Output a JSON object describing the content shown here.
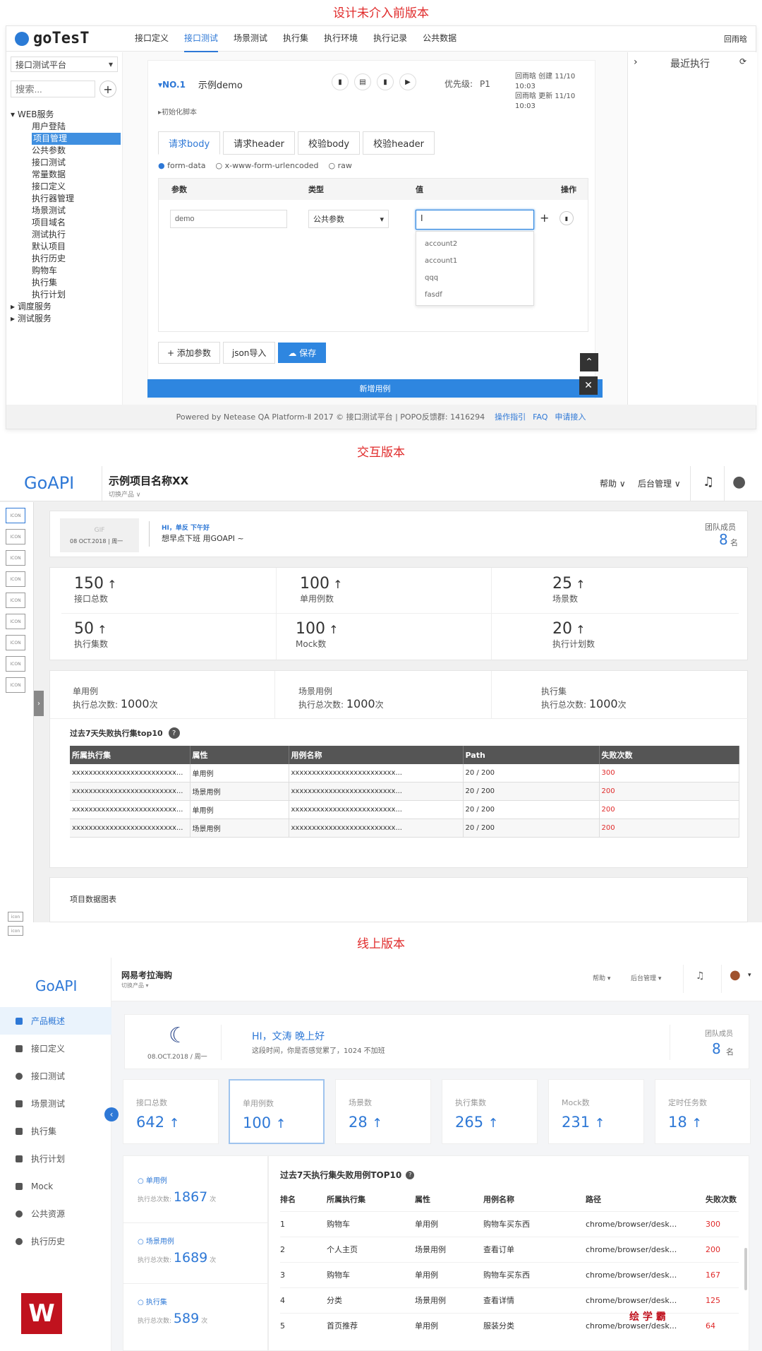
{
  "titles": {
    "before": "设计未介入前版本",
    "interactive": "交互版本",
    "online": "线上版本"
  },
  "s1": {
    "logo": "goTesT",
    "nav": [
      "接口定义",
      "接口测试",
      "场景测试",
      "执行集",
      "执行环境",
      "执行记录",
      "公共数据"
    ],
    "user": "回雨晗",
    "platform": "接口测试平台",
    "search_placeholder": "搜索...",
    "tree": {
      "root": "WEB服务",
      "items": [
        "用户登陆",
        "项目管理",
        "公共参数",
        "接口测试",
        "常量数据",
        "接口定义",
        "执行器管理",
        "场景测试",
        "项目域名",
        "测试执行",
        "默认项目",
        "执行历史",
        "购物车",
        "执行集",
        "执行计划"
      ],
      "selected": "项目管理",
      "closed": [
        "调度服务",
        "测试服务"
      ]
    },
    "case_no": "▾NO.1",
    "case_name": "示例demo",
    "priority_label": "优先级:",
    "priority": "P1",
    "meta1": "回雨晗 创建 11/10 10:03",
    "meta2": "回雨晗 更新 11/10 10:03",
    "init_script": "▸初始化脚本",
    "tabs": [
      "请求body",
      "请求header",
      "校验body",
      "校验header"
    ],
    "radios": [
      "form-data",
      "x-www-form-urlencoded",
      "raw"
    ],
    "cols": [
      "参数",
      "类型",
      "值",
      "操作"
    ],
    "row": {
      "param": "demo",
      "type": "公共参数",
      "value": "I"
    },
    "dropdown": [
      "account2",
      "account1",
      "qqq",
      "fasdf"
    ],
    "btn_add": "+ 添加参数",
    "btn_json": "json导入",
    "btn_save": "保存",
    "btn_new": "新增用例",
    "recent": "最近执行",
    "footer": "Powered by Netease QA Platform-Ⅱ 2017 © 接口测试平台 | POPO反馈群: 1416294",
    "footer_links": [
      "操作指引",
      "FAQ",
      "申请接入"
    ]
  },
  "s2": {
    "logo": "GoAPI",
    "project": "示例项目名称XX",
    "switch": "切换产品 ∨",
    "help": "帮助 ∨",
    "admin": "后台管理 ∨",
    "gif": "GIF",
    "date": "08 OCT.2018 | 周一",
    "greet": "HI，单反 下午好",
    "slogan": "想早点下班 用GOAPI ~",
    "team_label": "团队成员",
    "team_num": "8",
    "team_unit": "名",
    "icon_label": "ICON",
    "small_icon": "icon",
    "stats": [
      {
        "v": "150",
        "l": "接口总数"
      },
      {
        "v": "100",
        "l": "单用例数"
      },
      {
        "v": "25",
        "l": "场景数"
      },
      {
        "v": "50",
        "l": "执行集数"
      },
      {
        "v": "100",
        "l": "Mock数"
      },
      {
        "v": "20",
        "l": "执行计划数"
      }
    ],
    "up": "↑",
    "runs": [
      {
        "t": "单用例",
        "p": "执行总次数:",
        "v": "1000",
        "u": "次"
      },
      {
        "t": "场景用例",
        "p": "执行总次数:",
        "v": "1000",
        "u": "次"
      },
      {
        "t": "执行集",
        "p": "执行总次数:",
        "v": "1000",
        "u": "次"
      }
    ],
    "table_title": "过去7天失败执行集top10",
    "help_mark": "?",
    "cols": [
      "所属执行集",
      "属性",
      "用例名称",
      "Path",
      "失败次数"
    ],
    "rows": [
      [
        "xxxxxxxxxxxxxxxxxxxxxxxxx...",
        "单用例",
        "xxxxxxxxxxxxxxxxxxxxxxxxx...",
        "20 / 200",
        "300"
      ],
      [
        "xxxxxxxxxxxxxxxxxxxxxxxxx...",
        "场景用例",
        "xxxxxxxxxxxxxxxxxxxxxxxxx...",
        "20 / 200",
        "200"
      ],
      [
        "xxxxxxxxxxxxxxxxxxxxxxxxx...",
        "单用例",
        "xxxxxxxxxxxxxxxxxxxxxxxxx...",
        "20 / 200",
        "200"
      ],
      [
        "xxxxxxxxxxxxxxxxxxxxxxxxx...",
        "场景用例",
        "xxxxxxxxxxxxxxxxxxxxxxxxx...",
        "20 / 200",
        "200"
      ]
    ],
    "chart_title": "项目数据图表"
  },
  "s3": {
    "logo": "GoAPI",
    "project": "网易考拉海购",
    "switch": "切换产品 ▾",
    "help": "帮助 ▾",
    "admin": "后台管理 ▾",
    "menu": [
      "产品概述",
      "接口定义",
      "接口测试",
      "场景测试",
      "执行集",
      "执行计划",
      "Mock",
      "公共资源",
      "执行历史"
    ],
    "date": "08.OCT.2018 / 周一",
    "greet": "HI，文涛 晚上好",
    "sub": "这段时间，你是否感觉累了，1024 不加班",
    "team_label": "团队成员",
    "team_num": "8",
    "team_unit": "名",
    "stats": [
      {
        "l": "接口总数",
        "v": "642"
      },
      {
        "l": "单用例数",
        "v": "100"
      },
      {
        "l": "场景数",
        "v": "28"
      },
      {
        "l": "执行集数",
        "v": "265"
      },
      {
        "l": "Mock数",
        "v": "231"
      },
      {
        "l": "定时任务数",
        "v": "18"
      }
    ],
    "up": "↑",
    "runs": [
      {
        "t": "单用例",
        "p": "执行总次数:",
        "v": "1867",
        "u": "次"
      },
      {
        "t": "场景用例",
        "p": "执行总次数:",
        "v": "1689",
        "u": "次"
      },
      {
        "t": "执行集",
        "p": "执行总次数:",
        "v": "589",
        "u": "次"
      }
    ],
    "table_title": "过去7天执行集失败用例TOP10",
    "cols": [
      "排名",
      "所属执行集",
      "属性",
      "用例名称",
      "路径",
      "失败次数"
    ],
    "rows": [
      [
        "1",
        "购物车",
        "单用例",
        "购物车买东西",
        "chrome/browser/desk...",
        "300"
      ],
      [
        "2",
        "个人主页",
        "场景用例",
        "查看订单",
        "chrome/browser/desk...",
        "200"
      ],
      [
        "3",
        "购物车",
        "单用例",
        "购物车买东西",
        "chrome/browser/desk...",
        "167"
      ],
      [
        "4",
        "分类",
        "场景用例",
        "查看详情",
        "chrome/browser/desk...",
        "125"
      ],
      [
        "5",
        "首页推荐",
        "单用例",
        "服装分类",
        "chrome/browser/desk...",
        "64"
      ]
    ],
    "brand": "绘 学 霸"
  },
  "colors": {
    "red": "#e02a2a",
    "blue": "#2e78d6"
  }
}
